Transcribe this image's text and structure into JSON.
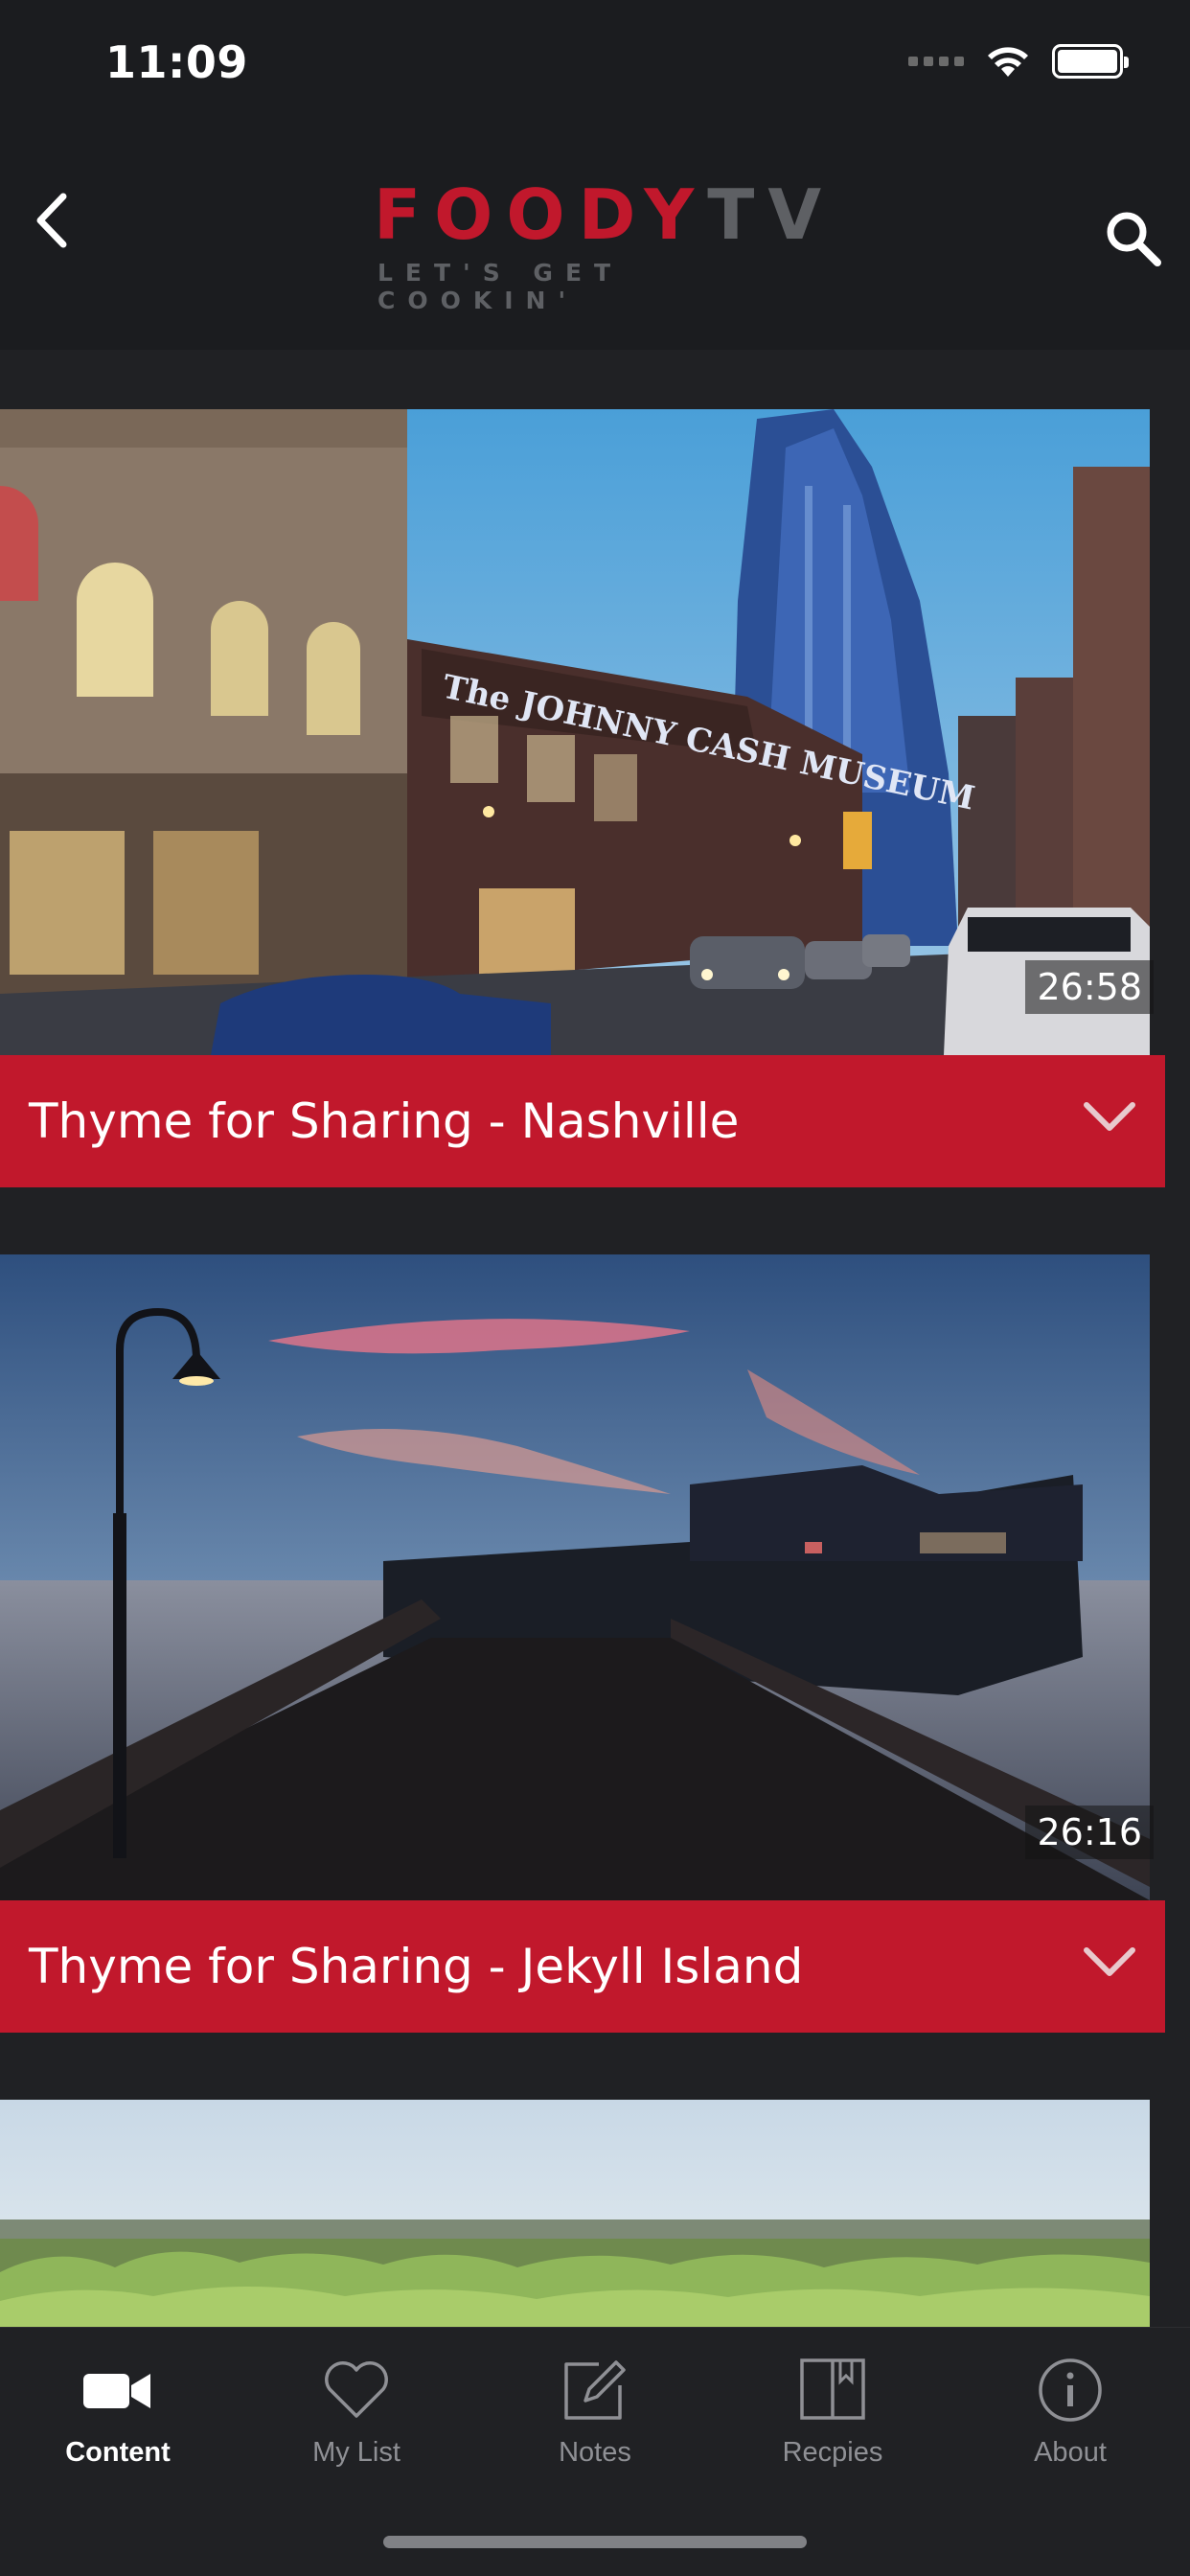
{
  "status_bar": {
    "time": "11:09"
  },
  "header": {
    "logo_part1": "FOODY",
    "logo_part2": "TV",
    "tagline": "LET'S GET COOKIN'"
  },
  "episodes": [
    {
      "title": "Thyme for Sharing - Nashville",
      "duration": "26:58"
    },
    {
      "title": "Thyme for Sharing - Jekyll Island",
      "duration": "26:16"
    }
  ],
  "tabs": [
    {
      "label": "Content",
      "icon": "video-camera-icon",
      "active": true
    },
    {
      "label": "My List",
      "icon": "heart-icon",
      "active": false
    },
    {
      "label": "Notes",
      "icon": "edit-note-icon",
      "active": false
    },
    {
      "label": "Recpies",
      "icon": "book-icon",
      "active": false
    },
    {
      "label": "About",
      "icon": "info-icon",
      "active": false
    }
  ],
  "colors": {
    "brand_red": "#c1182c",
    "background": "#202124"
  }
}
